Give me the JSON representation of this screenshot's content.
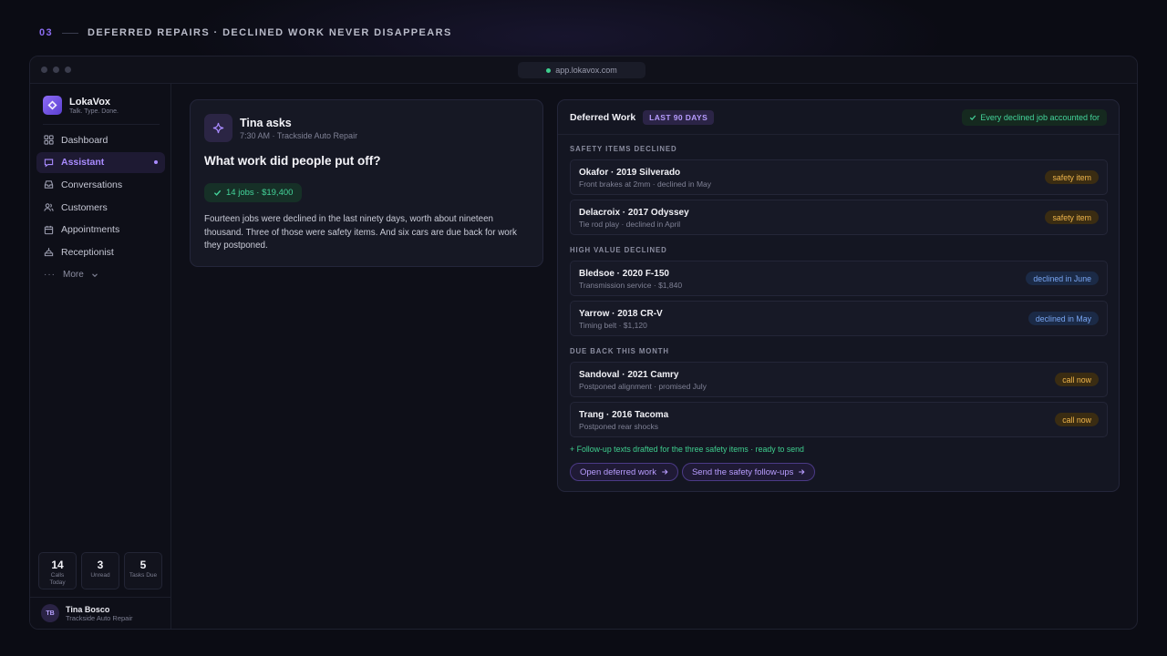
{
  "eyebrow": {
    "number": "03",
    "text": "DEFERRED REPAIRS · DECLINED WORK NEVER DISAPPEARS"
  },
  "browser": {
    "url": "app.lokavox.com"
  },
  "brand": {
    "name": "LokaVox",
    "tagline": "Talk. Type. Done."
  },
  "nav": [
    {
      "label": "Dashboard",
      "icon": "grid-icon",
      "active": false
    },
    {
      "label": "Assistant",
      "icon": "chat-bubble-icon",
      "active": true
    },
    {
      "label": "Conversations",
      "icon": "inbox-icon",
      "active": false
    },
    {
      "label": "Customers",
      "icon": "users-icon",
      "active": false
    },
    {
      "label": "Appointments",
      "icon": "calendar-icon",
      "active": false
    },
    {
      "label": "Receptionist",
      "icon": "phone-desk-icon",
      "active": false
    }
  ],
  "nav_more": "More",
  "stats": [
    {
      "value": "14",
      "label": "Calls Today"
    },
    {
      "value": "3",
      "label": "Unread"
    },
    {
      "value": "5",
      "label": "Tasks Due"
    }
  ],
  "user": {
    "initials": "TB",
    "name": "Tina Bosco",
    "org": "Trackside Auto Repair"
  },
  "ask": {
    "who": "Tina asks",
    "meta": "7:30 AM · Trackside Auto Repair",
    "question": "What work did people put off?",
    "badge": "14 jobs · $19,400",
    "body": "Fourteen jobs were declined in the last ninety days, worth about nineteen thousand. Three of those were safety items. And six cars are due back for work they postponed."
  },
  "panel": {
    "title": "Deferred Work",
    "range": "LAST 90 DAYS",
    "status": "Every declined job accounted for",
    "sections": [
      {
        "label": "SAFETY ITEMS DECLINED",
        "rows": [
          {
            "title": "Okafor · 2019 Silverado",
            "sub": "Front brakes at 2mm · declined in May",
            "tag": "safety item",
            "tone": "amber"
          },
          {
            "title": "Delacroix · 2017 Odyssey",
            "sub": "Tie rod play · declined in April",
            "tag": "safety item",
            "tone": "amber"
          }
        ]
      },
      {
        "label": "HIGH VALUE DECLINED",
        "rows": [
          {
            "title": "Bledsoe · 2020 F-150",
            "sub": "Transmission service · $1,840",
            "tag": "declined in June",
            "tone": "blue"
          },
          {
            "title": "Yarrow · 2018 CR-V",
            "sub": "Timing belt · $1,120",
            "tag": "declined in May",
            "tone": "blue"
          }
        ]
      },
      {
        "label": "DUE BACK THIS MONTH",
        "rows": [
          {
            "title": "Sandoval · 2021 Camry",
            "sub": "Postponed alignment · promised July",
            "tag": "call now",
            "tone": "amber"
          },
          {
            "title": "Trang · 2016 Tacoma",
            "sub": "Postponed rear shocks",
            "tag": "call now",
            "tone": "amber"
          }
        ]
      }
    ],
    "note": "+ Follow-up texts drafted for the three safety items · ready to send",
    "actions": [
      "Open deferred work",
      "Send the safety follow-ups"
    ]
  },
  "colors": {
    "accent": "#a98bff",
    "success": "#43d39a",
    "warning": "#f1b64b",
    "info": "#79a6f3"
  }
}
